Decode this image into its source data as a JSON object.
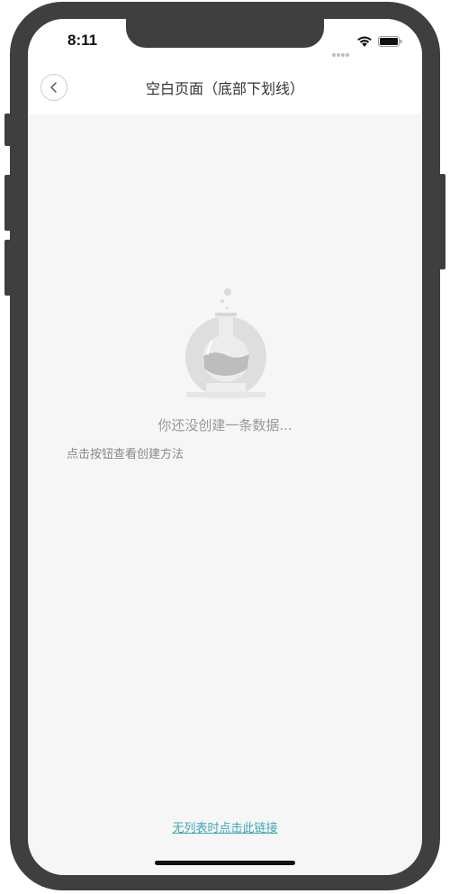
{
  "status_bar": {
    "time": "8:11"
  },
  "nav": {
    "title": "空白页面（底部下划线）",
    "back_icon": "chevron-left-icon"
  },
  "empty_state": {
    "illustration": "flask-icon",
    "message": "你还没创建一条数据...",
    "hint": "点击按钮查看创建方法"
  },
  "footer": {
    "link_text": "无列表时点击此链接",
    "link_color": "#3fa7b4"
  },
  "colors": {
    "page_background": "#f6f6f6",
    "device_frame": "#3f3f3f"
  }
}
